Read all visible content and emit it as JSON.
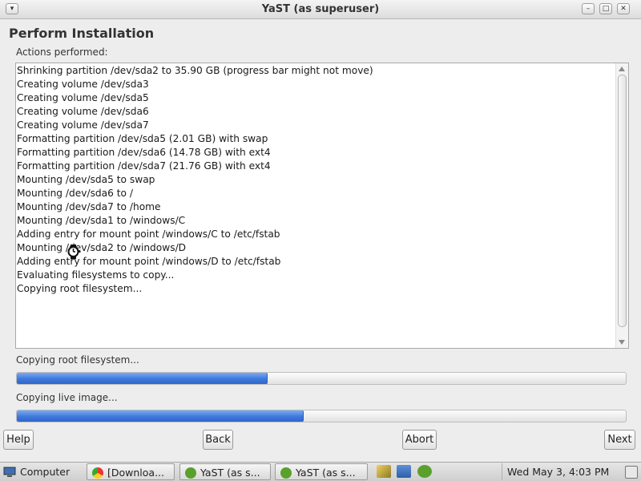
{
  "window": {
    "title": "YaST (as superuser)",
    "menu_glyph": "▾",
    "minimize_glyph": "–",
    "maximize_glyph": "□",
    "close_glyph": "✕"
  },
  "page": {
    "heading": "Perform Installation",
    "actions_label": "Actions performed:"
  },
  "log": [
    "Shrinking partition /dev/sda2 to 35.90 GB (progress bar might not move)",
    "Creating volume /dev/sda3",
    "Creating volume /dev/sda5",
    "Creating volume /dev/sda6",
    "Creating volume /dev/sda7",
    "Formatting partition /dev/sda5 (2.01 GB) with swap",
    "Formatting partition /dev/sda6 (14.78 GB) with ext4",
    "Formatting partition /dev/sda7 (21.76 GB) with ext4",
    "Mounting /dev/sda5 to swap",
    "Mounting /dev/sda6 to /",
    "Mounting /dev/sda7 to /home",
    "Mounting /dev/sda1 to /windows/C",
    "Adding entry for mount point /windows/C to /etc/fstab",
    "Mounting /dev/sda2 to /windows/D",
    "Adding entry for mount point /windows/D to /etc/fstab",
    "Evaluating filesystems to copy...",
    "Copying root filesystem..."
  ],
  "progress": {
    "current_label": "Copying root filesystem...",
    "current_fraction": 0.41,
    "overall_label": "Copying live image...",
    "overall_fraction": 0.47
  },
  "buttons": {
    "help": "Help",
    "back": "Back",
    "abort": "Abort",
    "next": "Next"
  },
  "taskbar": {
    "start_label": "Computer",
    "tasks": [
      "[Downloa...",
      "YaST (as s...",
      "YaST (as s..."
    ],
    "clock": "Wed May  3,  4:03 PM"
  },
  "colors": {
    "progress_fill": "#3f78de",
    "window_bg": "#ededed",
    "tray_green": "#5aa02c"
  }
}
